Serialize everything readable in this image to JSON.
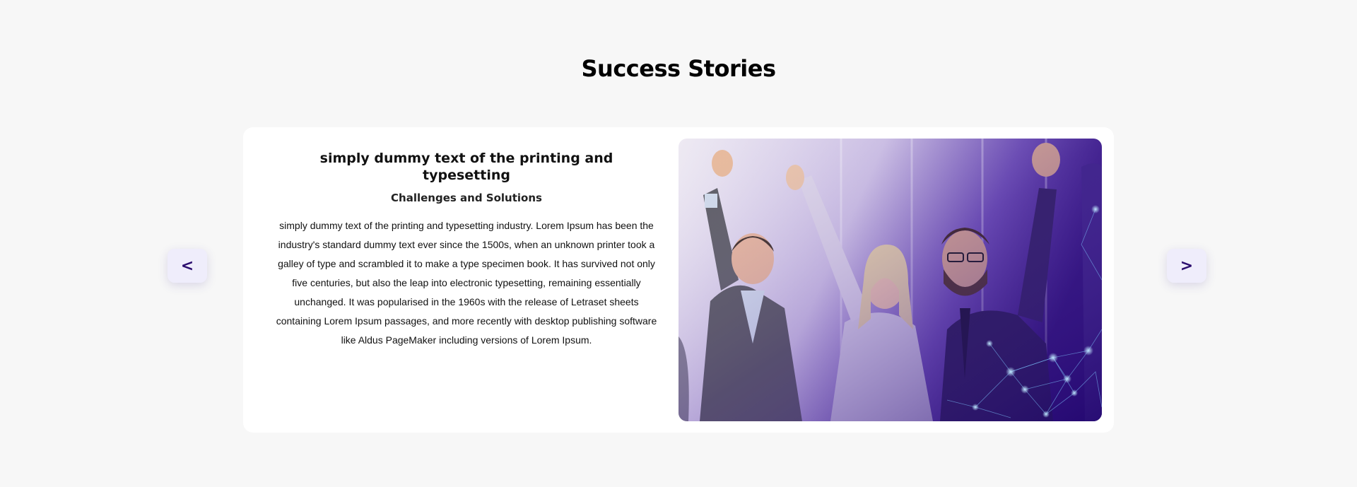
{
  "section": {
    "title": "Success Stories"
  },
  "story": {
    "title": "simply dummy text of the printing and typesetting",
    "subtitle": "Challenges and Solutions",
    "body": "simply dummy text of the printing and typesetting industry. Lorem Ipsum has been the industry's standard dummy text ever since the 1500s, when an unknown printer took a galley of type and scrambled it to make a type specimen book. It has survived not only five centuries, but also the leap into electronic typesetting, remaining essentially unchanged. It was popularised in the 1960s with the release of Letraset sheets containing Lorem Ipsum passages, and more recently with desktop publishing software like Aldus PageMaker including versions of Lorem Ipsum.",
    "image_icon": "celebrating-team-photo"
  },
  "carousel": {
    "prev_label": "<",
    "next_label": ">"
  },
  "colors": {
    "page_background": "#f7f7f7",
    "card_background": "#ffffff",
    "accent": "#2b0d6e",
    "button_background": "#efedfb",
    "image_overlay": "#3a1a8a"
  }
}
